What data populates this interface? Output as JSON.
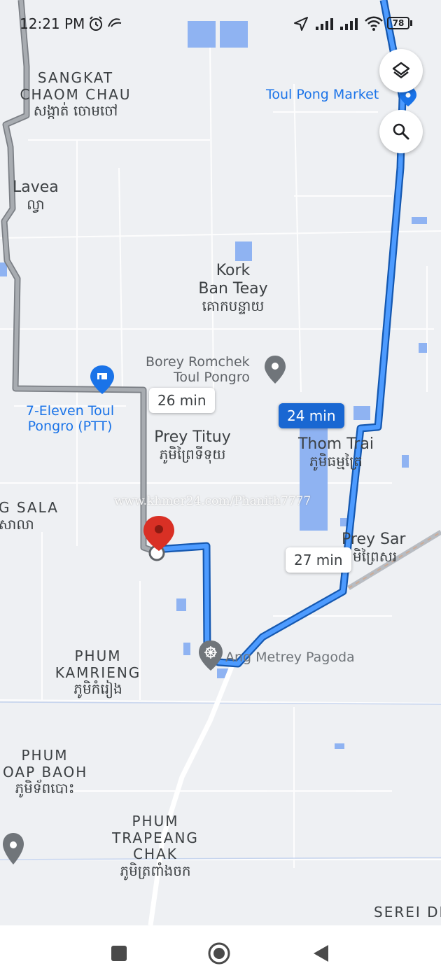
{
  "status_bar": {
    "time": "12:21 PM",
    "battery": "78"
  },
  "controls": {
    "layers": "layers-icon",
    "search": "search-icon"
  },
  "areas": {
    "sangkat_line1": "SANGKAT",
    "sangkat_line2": "CHAOM CHAU",
    "sangkat_khmer": "សង្កាត់ ចោមចៅ",
    "lavea": "Lavea",
    "lavea_khmer": "ល្វា",
    "kork_line1": "Kork",
    "kork_line2": "Ban Teay",
    "kork_khmer": "គោកបន្ទាយ",
    "prey_tituy": "Prey Tituy",
    "prey_tituy_khmer": "ភូមិព្រៃទីទុយ",
    "thom_trai": "Thom Trai",
    "thom_trai_khmer": "ភូមិធម្មត្រៃ",
    "prey_sar": "Prey Sar",
    "prey_sar_khmer": "មិព្រៃសរ",
    "g_sala": "G SALA",
    "g_sala_khmer": "សាលា",
    "kamrieng_line1": "PHUM",
    "kamrieng_line2": "KAMRIENG",
    "kamrieng_khmer": "ភូមិកំរៀង",
    "toap_line1": "PHUM",
    "toap_line2": "OAP BAOH",
    "toap_khmer": "ភូមិទ័ពបោះ",
    "trapeang_line1": "PHUM",
    "trapeang_line2": "TRAPEANG",
    "trapeang_line3": "CHAK",
    "trapeang_khmer": "ភូមិត្រពាំងចក",
    "serei": "SEREI DE"
  },
  "pois": {
    "toul_pong_market": "Toul Pong Market",
    "borey_line1": "Borey Romchek",
    "borey_line2": "Toul Pongro",
    "seven_eleven_line1": "7-Eleven Toul",
    "seven_eleven_line2": "Pongro (PTT)",
    "pagoda": "Ang Metrey Pagoda"
  },
  "routes": {
    "alt_left": "26 min",
    "selected": "24 min",
    "alt_right": "27 min",
    "colors": {
      "selected": "#1a73e8",
      "alternate": "#9aa0a6",
      "destination_pin": "#d93025"
    }
  },
  "watermark": "www.khmer24.com/Phanith7777"
}
